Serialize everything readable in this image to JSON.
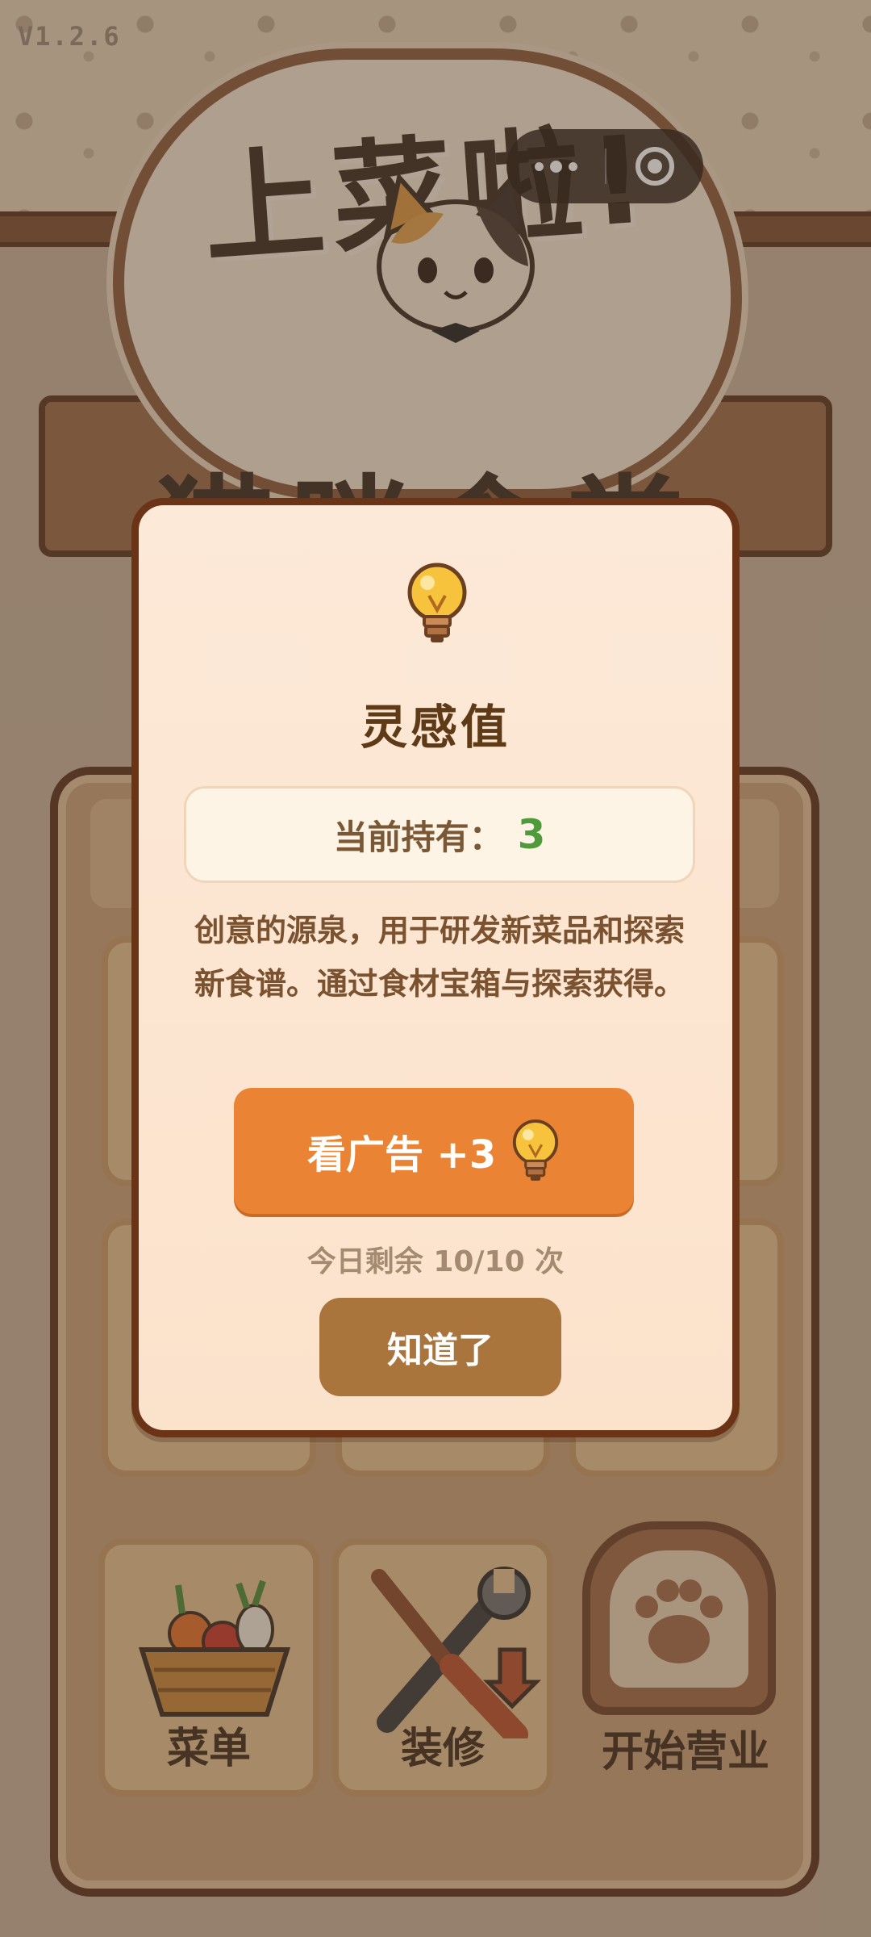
{
  "app": {
    "version": "V1.2.6",
    "logo_title": "上菜啦!",
    "logo_subtitle": "猫咪食堂"
  },
  "capsule": {
    "more_icon": "more-dots-icon",
    "close_icon": "miniprogram-close-icon"
  },
  "bottom_menu": {
    "items": [
      {
        "label": "菜单",
        "icon": "vegetable-basket-icon"
      },
      {
        "label": "装修",
        "icon": "wrench-screwdriver-icon"
      },
      {
        "label": "开始营业",
        "icon": "paw-door-icon"
      }
    ]
  },
  "modal": {
    "icon": "lightbulb-icon",
    "title": "灵感值",
    "holding_label": "当前持有：",
    "holding_value": "3",
    "description": "创意的源泉，用于研发新菜品和探索新食谱。通过食材宝箱与探索获得。",
    "ad_button_label": "看广告 +3",
    "ad_button_icon": "lightbulb-icon",
    "remaining_text": "今日剩余 10/10 次",
    "ok_button_label": "知道了"
  },
  "colors": {
    "modal_border": "#6b3417",
    "modal_bg": "#fde9d8",
    "ad_button": "#ea8334",
    "ok_button": "#a9753c",
    "holding_value": "#4f9a3a",
    "title_text": "#5e3a16"
  }
}
